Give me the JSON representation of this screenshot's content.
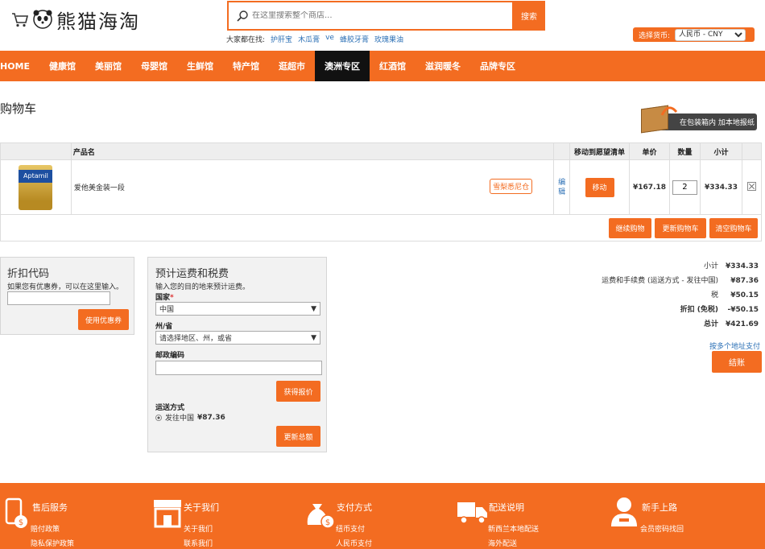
{
  "header": {
    "logo_text": "熊猫海淘",
    "search_placeholder": "在这里搜索整个商店...",
    "search_button": "搜索",
    "hot_label": "大家都在找:",
    "hot_links": [
      "护肝宝",
      "木瓜膏",
      "ve",
      "蜂胶牙膏",
      "玫瑰果油"
    ],
    "currency_label": "选择货币:",
    "currency_value": "人民币 - CNY"
  },
  "nav": [
    "HOME",
    "健康馆",
    "美丽馆",
    "母婴馆",
    "生鲜馆",
    "特产馆",
    "逛超市",
    "澳洲专区",
    "红酒馆",
    "滋润暖冬",
    "品牌专区"
  ],
  "nav_active_index": 7,
  "page": {
    "title": "购物车",
    "promo": "在包装箱内 加本地报纸"
  },
  "cart": {
    "headers": {
      "product": "产品名",
      "wishlist": "移动到愿望清单",
      "price": "单价",
      "qty": "数量",
      "subtotal": "小计"
    },
    "items": [
      {
        "image_label": "Aptamil",
        "name": "爱他美金装一段",
        "warehouse": "雪梨悉尼仓",
        "edit": "编辑",
        "move": "移动",
        "price": "¥167.18",
        "qty": "2",
        "subtotal": "¥334.33"
      }
    ],
    "buttons": {
      "continue": "继续购物",
      "update": "更新购物车",
      "clear": "清空购物车"
    }
  },
  "discount": {
    "title": "折扣代码",
    "desc": "如果您有优惠券，可以在这里输入。",
    "button": "使用优惠券"
  },
  "shipping": {
    "title": "预计运费和税费",
    "desc": "输入您的目的地来预计运费。",
    "country_label": "国家",
    "required_mark": "*",
    "country_value": "中国",
    "state_label": "州/省",
    "state_value": "请选择地区、州，或省",
    "zip_label": "邮政编码",
    "quote_button": "获得报价",
    "method_label": "运送方式",
    "method_value": "发往中国",
    "method_price": "¥87.36",
    "update_button": "更新总额"
  },
  "totals": {
    "rows": [
      {
        "label": "小计",
        "value": "¥334.33",
        "bold": false
      },
      {
        "label": "运费和手续费 (运送方式 - 发往中国)",
        "value": "¥87.36",
        "bold": false
      },
      {
        "label": "税",
        "value": "¥50.15",
        "bold": false
      },
      {
        "label": "折扣 (免税)",
        "value": "-¥50.15",
        "bold": true
      },
      {
        "label": "总计",
        "value": "¥421.69",
        "bold": true
      }
    ],
    "multi_address": "按多个地址支付",
    "checkout": "结账"
  },
  "footer": [
    {
      "title": "售后服务",
      "links": [
        "赔付政策",
        "隐私保护政策"
      ]
    },
    {
      "title": "关于我们",
      "links": [
        "关于我们",
        "联系我们"
      ]
    },
    {
      "title": "支付方式",
      "links": [
        "纽币支付",
        "人民币支付"
      ]
    },
    {
      "title": "配送说明",
      "links": [
        "新西兰本地配送",
        "海外配送"
      ]
    },
    {
      "title": "新手上路",
      "links": [
        "会员密码找回"
      ]
    }
  ],
  "colors": {
    "accent": "#f36c21",
    "nav_active": "#111111",
    "link": "#2a6fb5"
  }
}
